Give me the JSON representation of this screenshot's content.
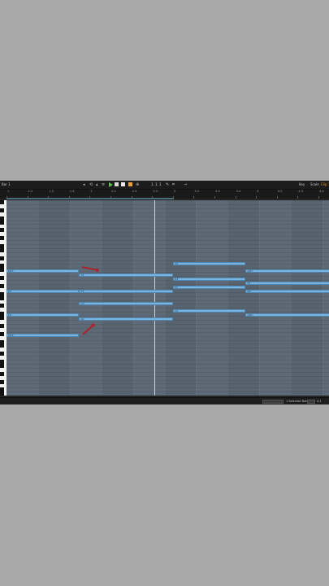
{
  "toolbar": {
    "left_label": "Bar 1",
    "position": "1. 1. 1",
    "key_label": "Key",
    "scale_label": "Scale",
    "clip_label": "Clip 1"
  },
  "ruler": {
    "markers": [
      "1",
      "1.2",
      "1.3",
      "1.4",
      "2",
      "2.2",
      "2.3",
      "2.4",
      "3",
      "3.2",
      "3.3",
      "3.4",
      "4",
      "4.2",
      "4.3",
      "4.4"
    ]
  },
  "status": {
    "label": "1 Selected Notes",
    "value": "4.1"
  },
  "notes": [
    {
      "label": "A#3",
      "start": 0,
      "length": 2.3,
      "row": 17
    },
    {
      "label": "G3",
      "start": 0,
      "length": 2.3,
      "row": 22
    },
    {
      "label": "D3",
      "start": 0,
      "length": 2.3,
      "row": 28
    },
    {
      "label": "A#2",
      "start": 0,
      "length": 2.3,
      "row": 33
    },
    {
      "label": "A3",
      "start": 2.3,
      "length": 2.97,
      "row": 18
    },
    {
      "label": "F3",
      "start": 2.3,
      "length": 2.97,
      "row": 22
    },
    {
      "label": "C3",
      "start": 2.3,
      "length": 2.97,
      "row": 25
    },
    {
      "label": "A2",
      "start": 2.3,
      "length": 2.97,
      "row": 29
    },
    {
      "label": "C4",
      "start": 5.27,
      "length": 2.3,
      "row": 15
    },
    {
      "label": "G3",
      "start": 5.27,
      "length": 2.3,
      "row": 19
    },
    {
      "label": "E3",
      "start": 5.27,
      "length": 2.3,
      "row": 21
    },
    {
      "label": "C3",
      "start": 5.27,
      "length": 2.3,
      "row": 27
    },
    {
      "label": "A#3",
      "start": 7.57,
      "length": 2.7,
      "row": 17
    },
    {
      "label": "F3",
      "start": 7.57,
      "length": 2.7,
      "row": 20
    },
    {
      "label": "D3",
      "start": 7.57,
      "length": 2.7,
      "row": 22
    },
    {
      "label": "A#2",
      "start": 7.57,
      "length": 2.7,
      "row": 28
    }
  ],
  "colors": {
    "note": "#7bb4de",
    "grid": "#5d6a76",
    "annotation": "#b0202a",
    "play": "#59c24f"
  }
}
